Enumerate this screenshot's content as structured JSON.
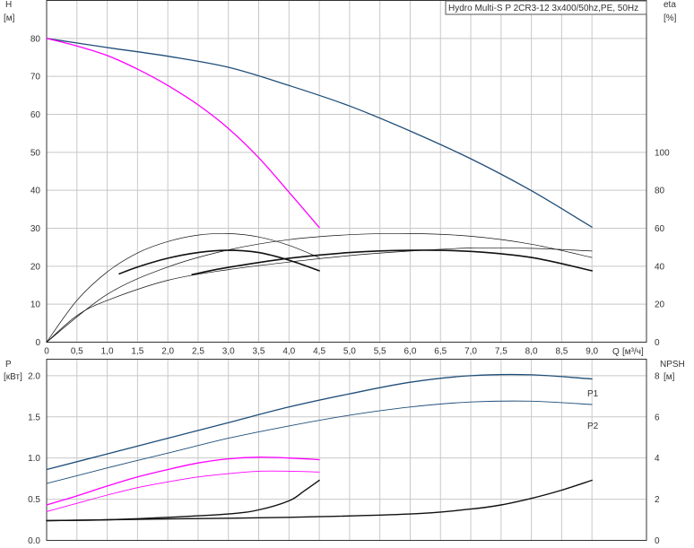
{
  "header": {
    "pump_title": "Hydro Multi-S P 2CR3-12 3x400/50hz,PE, 50Hz"
  },
  "colors": {
    "blue": "#1f4e79",
    "magenta": "#ff00ff",
    "black": "#111111"
  },
  "chart_data": [
    {
      "type": "line",
      "name": "head_efficiency",
      "x_label": "Q",
      "x_unit": "[м³/ч]",
      "y_left_label": "H",
      "y_left_unit": "[м]",
      "y_right_label": "eta",
      "y_right_unit": "[%]",
      "xlim": [
        0,
        9.9
      ],
      "ylim_left": [
        0,
        90
      ],
      "ylim_right": [
        0,
        180
      ],
      "grid": true,
      "x_ticks": [
        "0",
        "0,5",
        "1,0",
        "1,5",
        "2,0",
        "2,5",
        "3,0",
        "3,5",
        "4,0",
        "4,5",
        "5,0",
        "5,5",
        "6,0",
        "6,5",
        "7,0",
        "7,5",
        "8,0",
        "8,5",
        "9,0"
      ],
      "y_left_ticks": [
        "0",
        "10",
        "20",
        "30",
        "40",
        "50",
        "60",
        "70",
        "80"
      ],
      "y_right_ticks": [
        "0",
        "20",
        "40",
        "60",
        "80",
        "100"
      ],
      "series": [
        {
          "color": "blue",
          "axis": "left",
          "x": [
            0,
            1,
            2,
            3,
            4,
            5,
            6,
            7,
            8,
            9
          ],
          "y": [
            80,
            77.6,
            75.3,
            72.4,
            67.6,
            62.2,
            55.6,
            48.3,
            39.9,
            30.3
          ]
        },
        {
          "color": "magenta",
          "axis": "left",
          "x": [
            0,
            0.5,
            1,
            1.5,
            2,
            2.5,
            3,
            3.5,
            4,
            4.5
          ],
          "y": [
            80,
            78,
            75.5,
            71.9,
            67.6,
            62.5,
            56.3,
            48.6,
            39.5,
            30.2
          ]
        },
        {
          "color": "black",
          "axis": "right",
          "width": 0.7,
          "x": [
            0,
            0.5,
            1,
            1.5,
            2,
            2.5,
            3,
            3.5,
            4,
            4.5
          ],
          "y": [
            0,
            22,
            37,
            47,
            53,
            56.4,
            57.2,
            55.4,
            51,
            44.5
          ]
        },
        {
          "color": "black",
          "axis": "right",
          "width": 1.6,
          "x": [
            1.2,
            1.5,
            2,
            2.5,
            3,
            3.5,
            4,
            4.5
          ],
          "y": [
            36,
            39.6,
            44.2,
            47.2,
            48.4,
            47.2,
            43.2,
            37.6
          ]
        },
        {
          "color": "black",
          "axis": "right",
          "width": 0.7,
          "x": [
            0,
            1,
            2,
            3,
            4,
            5,
            6,
            7,
            8,
            9
          ],
          "y": [
            0,
            25.2,
            39.6,
            48.6,
            54,
            56.6,
            57.2,
            55.8,
            51.6,
            44.6
          ]
        },
        {
          "color": "black",
          "axis": "right",
          "width": 1.6,
          "x": [
            2.4,
            3,
            4,
            5,
            6,
            7,
            8,
            9
          ],
          "y": [
            35.6,
            39.4,
            44.2,
            47.2,
            48.4,
            47.8,
            44.6,
            37.6
          ]
        },
        {
          "color": "black",
          "axis": "right",
          "width": 0.7,
          "x": [
            0,
            0.5,
            1,
            2,
            3,
            4,
            5,
            6,
            7,
            8,
            9
          ],
          "y": [
            0,
            14,
            22,
            32.6,
            38.2,
            42.2,
            45.6,
            48,
            49.6,
            49.4,
            48
          ]
        }
      ]
    },
    {
      "type": "line",
      "name": "power_npsh",
      "y_left_label": "P",
      "y_left_unit": "[кВт]",
      "y_right_label": "NPSH",
      "y_right_unit": "[м]",
      "xlim": [
        0,
        9.9
      ],
      "ylim_left": [
        0,
        2.2
      ],
      "ylim_right": [
        0,
        8.8
      ],
      "grid": true,
      "y_left_ticks": [
        "0.0",
        "0.5",
        "1.0",
        "1.5",
        "2.0"
      ],
      "y_right_ticks": [
        "0",
        "2",
        "4",
        "6",
        "8"
      ],
      "series": [
        {
          "name": "P1",
          "color": "blue",
          "axis": "left",
          "width": 1.3,
          "x": [
            0,
            1,
            2,
            3,
            4,
            5,
            6,
            7,
            8,
            9
          ],
          "y": [
            0.86,
            1.05,
            1.24,
            1.43,
            1.62,
            1.78,
            1.92,
            2.0,
            2.01,
            1.96
          ]
        },
        {
          "name": "P2",
          "color": "blue",
          "axis": "left",
          "width": 0.9,
          "x": [
            0,
            1,
            2,
            3,
            4,
            5,
            6,
            7,
            8,
            9
          ],
          "y": [
            0.69,
            0.88,
            1.06,
            1.24,
            1.39,
            1.52,
            1.62,
            1.68,
            1.69,
            1.65
          ]
        },
        {
          "color": "magenta",
          "axis": "left",
          "width": 1.3,
          "x": [
            0,
            0.5,
            1,
            1.5,
            2,
            2.5,
            3,
            3.5,
            4,
            4.5
          ],
          "y": [
            0.43,
            0.54,
            0.66,
            0.77,
            0.86,
            0.94,
            0.99,
            1.01,
            1.0,
            0.98
          ]
        },
        {
          "color": "magenta",
          "axis": "left",
          "width": 0.9,
          "x": [
            0,
            0.5,
            1,
            1.5,
            2,
            2.5,
            3,
            3.5,
            4,
            4.5
          ],
          "y": [
            0.35,
            0.45,
            0.55,
            0.64,
            0.71,
            0.77,
            0.81,
            0.84,
            0.84,
            0.83
          ]
        },
        {
          "color": "black",
          "axis": "right",
          "width": 1.4,
          "x": [
            0,
            1,
            2,
            3,
            3.5,
            4,
            4.25,
            4.5
          ],
          "y": [
            0.96,
            1.0,
            1.12,
            1.28,
            1.48,
            1.92,
            2.4,
            2.92
          ]
        },
        {
          "color": "black",
          "axis": "right",
          "width": 1.4,
          "x": [
            0,
            2,
            4,
            6,
            7,
            7.5,
            8,
            8.5,
            9
          ],
          "y": [
            0.96,
            1.04,
            1.12,
            1.28,
            1.52,
            1.72,
            2.04,
            2.44,
            2.92
          ]
        }
      ]
    }
  ]
}
